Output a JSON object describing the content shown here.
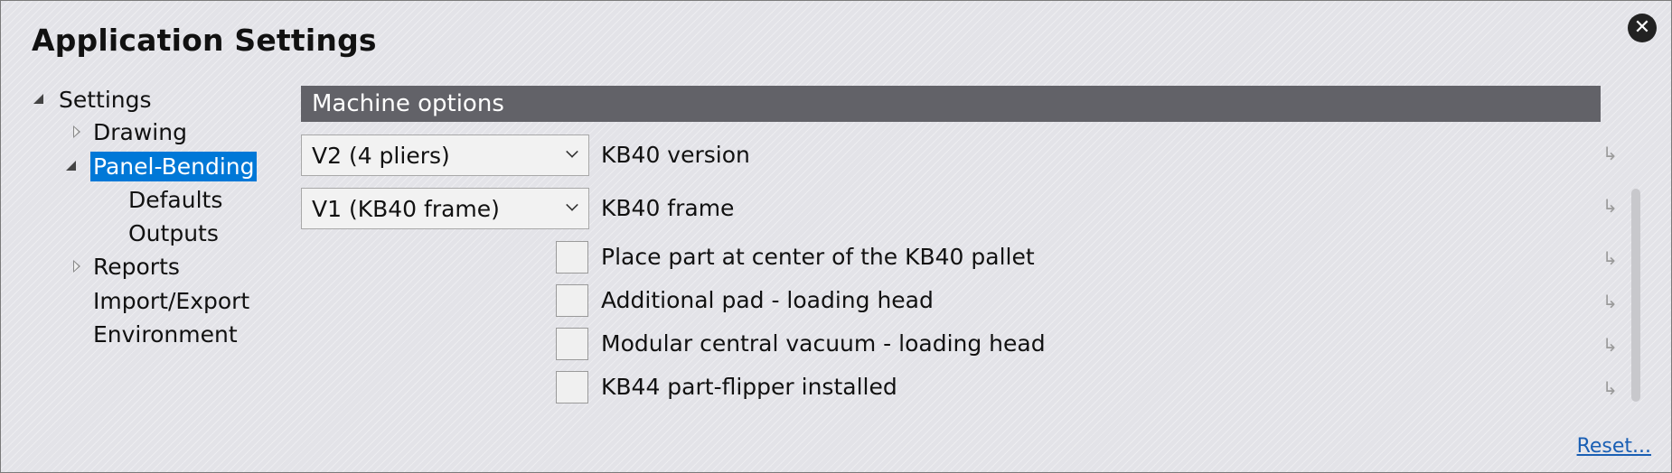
{
  "window": {
    "title": "Application Settings",
    "close_icon": "close-icon"
  },
  "tree": {
    "settings": "Settings",
    "drawing": "Drawing",
    "panel_bending": "Panel-Bending",
    "defaults": "Defaults",
    "outputs": "Outputs",
    "reports": "Reports",
    "import_export": "Import/Export",
    "environment": "Environment",
    "selected": "Panel-Bending"
  },
  "section": {
    "title": "Machine options"
  },
  "options": {
    "version_value": "V2 (4 pliers)",
    "version_label": "KB40 version",
    "frame_value": "V1 (KB40 frame)",
    "frame_label": "KB40 frame",
    "center_label": "Place part at center of the KB40 pallet",
    "pad_label": "Additional pad - loading head",
    "vacuum_label": "Modular central vacuum - loading head",
    "flipper_label": "KB44 part-flipper installed",
    "reset_glyph": "↳"
  },
  "footer": {
    "reset_label": "Reset..."
  },
  "colors": {
    "accent": "#0078d7",
    "header_bg": "#626268",
    "link": "#1a5fb4"
  }
}
